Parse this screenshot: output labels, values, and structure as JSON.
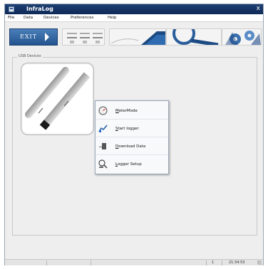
{
  "window": {
    "title": "InfraLog",
    "close_glyph": "x"
  },
  "menu": [
    "File",
    "Data",
    "Devices",
    "Preferences",
    "Help"
  ],
  "toolbar": {
    "exit_label": "EXIT"
  },
  "usb_panel": {
    "label": "USB Devices"
  },
  "context_menu": {
    "items": [
      {
        "label": "MeterMode",
        "icon": "gauge-icon"
      },
      {
        "label": "Start logger",
        "icon": "chart-icon"
      },
      {
        "label": "Download Data",
        "icon": "download-icon"
      },
      {
        "label": "Logger Setup",
        "icon": "setup-icon"
      }
    ]
  },
  "status": {
    "count": "1",
    "time": "21:34:53"
  },
  "colors": {
    "titlebar": "#14315f",
    "exit_button": "#2f63a3",
    "panel_bg": "#eeeeee"
  }
}
